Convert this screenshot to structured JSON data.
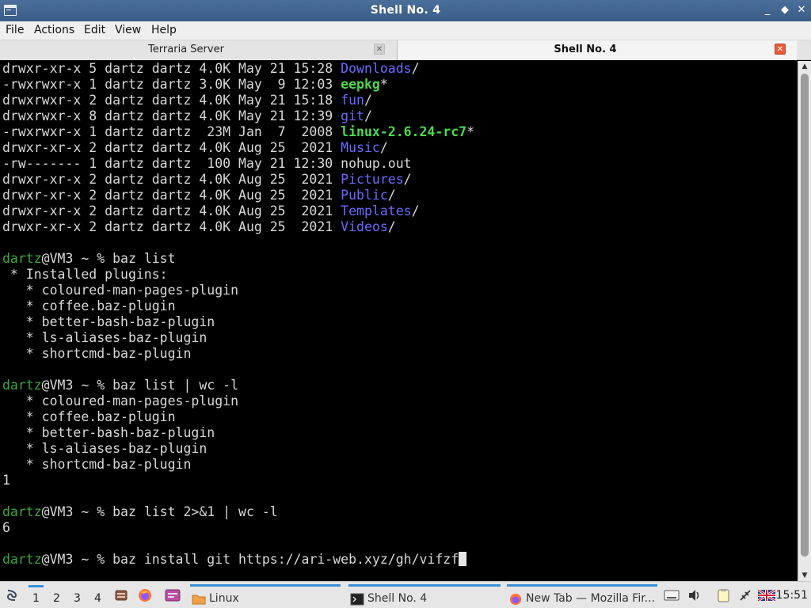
{
  "window": {
    "title": "Shell No. 4",
    "minimize": "_",
    "maximize": "◆",
    "close": "✕"
  },
  "menu": [
    "File",
    "Actions",
    "Edit",
    "View",
    "Help"
  ],
  "tabs": [
    {
      "label": "Terraria Server",
      "close": "✕"
    },
    {
      "label": "Shell No. 4",
      "close": "✕"
    }
  ],
  "terminal": {
    "ls_rows": [
      {
        "meta": "drwxr-xr-x 5 dartz dartz 4.0K May 21 15:28 ",
        "name": "Downloads",
        "suffix": "/",
        "kind": "dir"
      },
      {
        "meta": "-rwxrwxr-x 1 dartz dartz 3.0K May  9 12:03 ",
        "name": "eepkg",
        "suffix": "*",
        "kind": "exe"
      },
      {
        "meta": "drwxrwxr-x 2 dartz dartz 4.0K May 21 15:18 ",
        "name": "fun",
        "suffix": "/",
        "kind": "dir"
      },
      {
        "meta": "drwxrwxr-x 8 dartz dartz 4.0K May 21 12:39 ",
        "name": "git",
        "suffix": "/",
        "kind": "dir"
      },
      {
        "meta": "-rwxrwxr-x 1 dartz dartz  23M Jan  7  2008 ",
        "name": "linux-2.6.24-rc7",
        "suffix": "*",
        "kind": "exe"
      },
      {
        "meta": "drwxr-xr-x 2 dartz dartz 4.0K Aug 25  2021 ",
        "name": "Music",
        "suffix": "/",
        "kind": "dir"
      },
      {
        "meta": "-rw------- 1 dartz dartz  100 May 21 12:30 ",
        "name": "nohup.out",
        "suffix": "",
        "kind": "file"
      },
      {
        "meta": "drwxr-xr-x 2 dartz dartz 4.0K Aug 25  2021 ",
        "name": "Pictures",
        "suffix": "/",
        "kind": "dir"
      },
      {
        "meta": "drwxr-xr-x 2 dartz dartz 4.0K Aug 25  2021 ",
        "name": "Public",
        "suffix": "/",
        "kind": "dir"
      },
      {
        "meta": "drwxr-xr-x 2 dartz dartz 4.0K Aug 25  2021 ",
        "name": "Templates",
        "suffix": "/",
        "kind": "dir"
      },
      {
        "meta": "drwxr-xr-x 2 dartz dartz 4.0K Aug 25  2021 ",
        "name": "Videos",
        "suffix": "/",
        "kind": "dir"
      }
    ],
    "prompt_user": "dartz",
    "prompt_rest": "@VM3 ~ % ",
    "cmd1": "baz list",
    "installed_header": " * Installed plugins:",
    "plugins": [
      "   * coloured-man-pages-plugin",
      "   * coffee.baz-plugin",
      "   * better-bash-baz-plugin",
      "   * ls-aliases-baz-plugin",
      "   * shortcmd-baz-plugin"
    ],
    "cmd2": "baz list | wc -l",
    "out2": "1",
    "cmd3": "baz list 2>&1 | wc -l",
    "out3": "6",
    "cmd4": "baz install git https://ari-web.xyz/gh/vifzf"
  },
  "taskbar": {
    "desktops": [
      "1",
      "2",
      "3",
      "4"
    ],
    "folder_label": "Linux",
    "shell_label": "Shell No. 4",
    "firefox_label": "New Tab — Mozilla Fir...",
    "clock": "15:51"
  },
  "colors": {
    "dir": "#6b6bff",
    "exe": "#4cdb4c",
    "user": "#3aa83a",
    "accent": "#3b8fd9"
  }
}
